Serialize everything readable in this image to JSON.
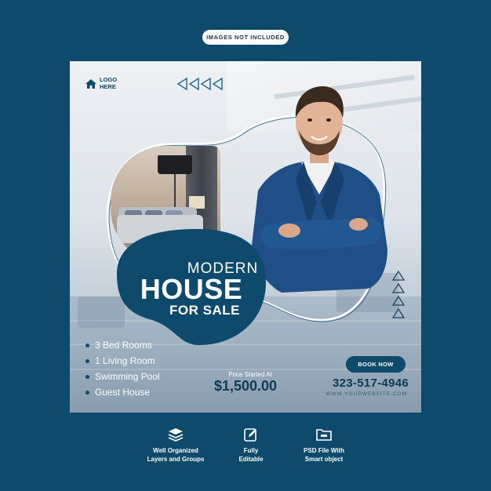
{
  "banner": "IMAGES NOT INCLUDED",
  "logo": {
    "line1": "LOGO",
    "line2": "HERE",
    "icon": "house-icon"
  },
  "headline": {
    "line1": "MODERN",
    "line2": "HOUSE",
    "line3": "FOR SALE"
  },
  "features": [
    "3 Bed Rooms",
    "1 Living Room",
    "Swimming Pool",
    "Guest House"
  ],
  "price": {
    "label": "Price Started At",
    "value": "$1,500.00"
  },
  "cta": {
    "label": "BOOK NOW"
  },
  "contact": {
    "phone": "323-517-4946",
    "website": "WWW.YOURWEBSITE.COM"
  },
  "bottom_features": [
    {
      "icon": "layers-icon",
      "line1": "Well Organized",
      "line2": "Layers and Groups"
    },
    {
      "icon": "edit-icon",
      "line1": "Fully",
      "line2": "Editable"
    },
    {
      "icon": "folder-icon",
      "line1": "PSD File With",
      "line2": "Smart object"
    }
  ],
  "colors": {
    "background": "#0d4a6c",
    "accent": "#0d4a6c",
    "white": "#ffffff"
  }
}
